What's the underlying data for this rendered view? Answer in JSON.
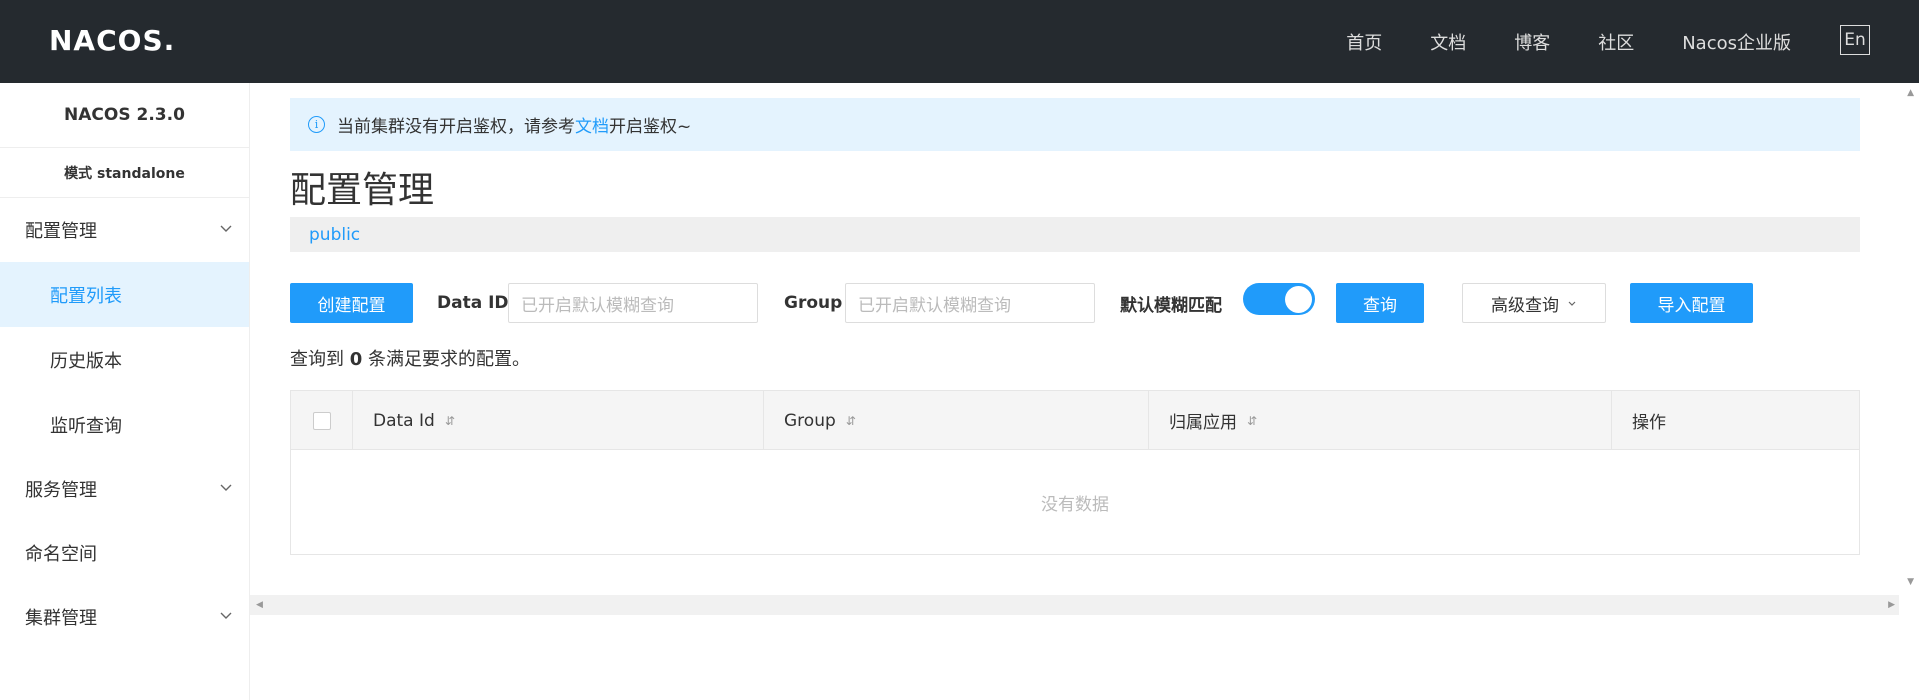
{
  "header": {
    "logo_text": "NACOS",
    "logo_dot": ".",
    "nav": [
      "首页",
      "文档",
      "博客",
      "社区",
      "Nacos企业版"
    ],
    "lang_button": "En"
  },
  "sidebar": {
    "version": "NACOS 2.3.0",
    "mode": "模式 standalone",
    "items": [
      {
        "label": "配置管理",
        "type": "group"
      },
      {
        "label": "配置列表",
        "type": "sub",
        "active": true
      },
      {
        "label": "历史版本",
        "type": "sub"
      },
      {
        "label": "监听查询",
        "type": "sub"
      },
      {
        "label": "服务管理",
        "type": "group"
      },
      {
        "label": "命名空间",
        "type": "item"
      },
      {
        "label": "集群管理",
        "type": "group"
      }
    ]
  },
  "alert": {
    "icon": "info-icon",
    "text_before": "当前集群没有开启鉴权，请参考",
    "link_text": "文档",
    "text_after": "开启鉴权~"
  },
  "page": {
    "title": "配置管理",
    "namespace": "public"
  },
  "toolbar": {
    "create_label": "创建配置",
    "data_id_label": "Data ID",
    "data_id_placeholder": "已开启默认模糊查询",
    "group_label": "Group",
    "group_placeholder": "已开启默认模糊查询",
    "fuzzy_label": "默认模糊匹配",
    "fuzzy_enabled": true,
    "query_label": "查询",
    "advanced_label": "高级查询",
    "import_label": "导入配置"
  },
  "result": {
    "prefix": "查询到",
    "count": "0",
    "suffix": "条满足要求的配置。"
  },
  "table": {
    "columns": [
      "Data Id",
      "Group",
      "归属应用",
      "操作"
    ],
    "empty_text": "没有数据"
  },
  "colors": {
    "header_bg": "#252a2f",
    "primary": "#209bfa",
    "active_bg": "#e4f3fe"
  }
}
